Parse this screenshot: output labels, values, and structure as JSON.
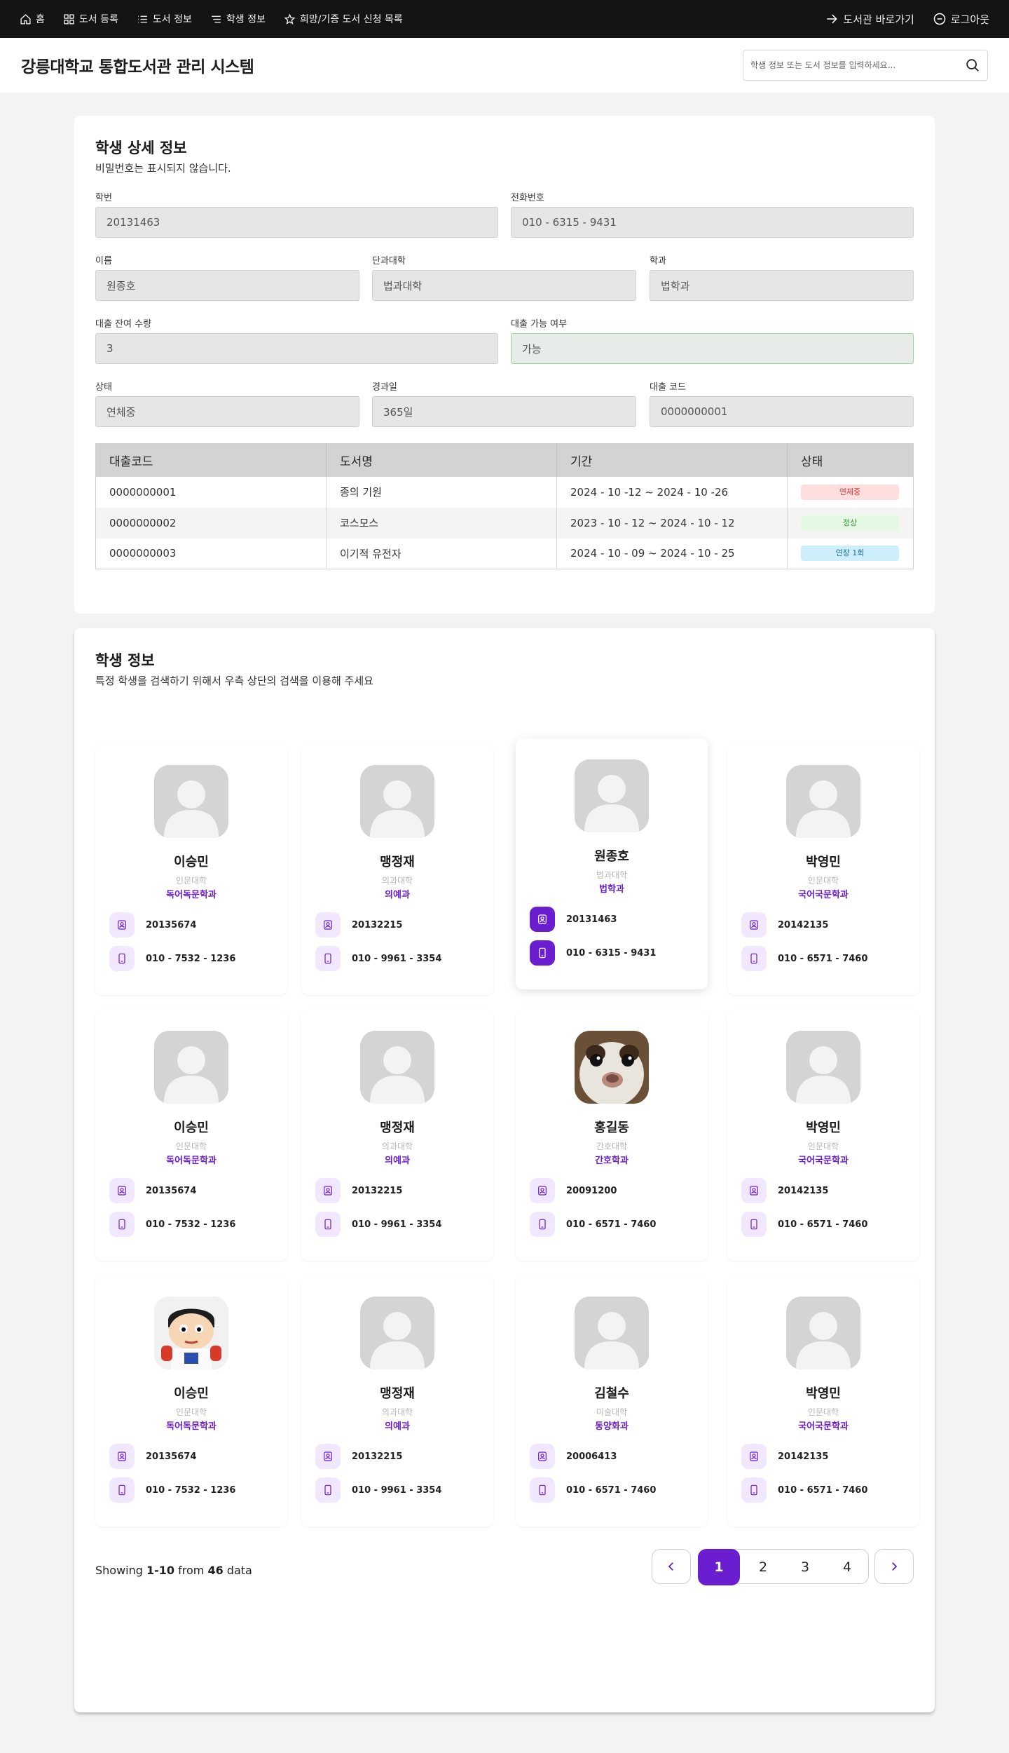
{
  "nav": {
    "items": [
      {
        "label": "홈",
        "icon": "home-icon"
      },
      {
        "label": "도서 등록",
        "icon": "grid-icon"
      },
      {
        "label": "도서 정보",
        "icon": "list-icon"
      },
      {
        "label": "학생 정보",
        "icon": "sort-icon"
      },
      {
        "label": "희망/기증 도서 신청 목록",
        "icon": "star-icon"
      }
    ],
    "library_link": "도서관 바로가기",
    "logout": "로그아웃"
  },
  "header": {
    "title": "강릉대학교 통합도서관 관리 시스템",
    "search_placeholder": "학생 정보 또는 도서 정보를 입력하세요..."
  },
  "detail": {
    "title": "학생 상세 정보",
    "subtitle": "비밀번호는 표시되지 않습니다.",
    "fields": {
      "student_id": {
        "label": "학번",
        "value": "20131463"
      },
      "phone": {
        "label": "전화번호",
        "value": "010 - 6315 - 9431"
      },
      "name": {
        "label": "이름",
        "value": "원종호"
      },
      "college": {
        "label": "단과대학",
        "value": "법과대학"
      },
      "dept": {
        "label": "학과",
        "value": "법학과"
      },
      "remaining": {
        "label": "대출 잔여 수량",
        "value": "3"
      },
      "available": {
        "label": "대출 가능 여부",
        "value": "가능"
      },
      "status": {
        "label": "상태",
        "value": "연체중"
      },
      "elapsed": {
        "label": "경과일",
        "value": "365일"
      },
      "loan_code": {
        "label": "대출 코드",
        "value": "0000000001"
      }
    },
    "table": {
      "headers": [
        "대출코드",
        "도서명",
        "기간",
        "상태"
      ],
      "rows": [
        {
          "code": "0000000001",
          "title": "종의 기원",
          "period": "2024 - 10 -12 ~ 2024 - 10 -26",
          "status": "연체중",
          "status_color": "#d93838",
          "status_bg": "#ffdede"
        },
        {
          "code": "0000000002",
          "title": "코스모스",
          "period": "2023 - 10 - 12 ~ 2024 - 10 - 12",
          "status": "정상",
          "status_color": "#3a9a3a",
          "status_bg": "#e4f8e4"
        },
        {
          "code": "0000000003",
          "title": "이기적 유전자",
          "period": "2024 - 10 - 09 ~ 2024 - 10 - 25",
          "status": "연장 1회",
          "status_color": "#1d6f9f",
          "status_bg": "#cdeefb"
        }
      ]
    }
  },
  "list": {
    "title": "학생 정보",
    "subtitle": "특정 학생을 검색하기 위해서 우측 상단의 검색을 이용해 주세요",
    "students": [
      {
        "name": "이승민",
        "college": "인문대학",
        "major": "독어독문학과",
        "id": "20135674",
        "phone": "010 - 7532 - 1236",
        "photo": "placeholder"
      },
      {
        "name": "맹정재",
        "college": "의과대학",
        "major": "의예과",
        "id": "20132215",
        "phone": "010 - 9961 - 3354",
        "photo": "placeholder"
      },
      {
        "name": "원종호",
        "college": "법과대학",
        "major": "법학과",
        "id": "20131463",
        "phone": "010 - 6315 - 9431",
        "photo": "placeholder",
        "active": true
      },
      {
        "name": "박영민",
        "college": "인문대학",
        "major": "국어국문학과",
        "id": "20142135",
        "phone": "010 - 6571 - 7460",
        "photo": "placeholder"
      },
      {
        "name": "이승민",
        "college": "인문대학",
        "major": "독어독문학과",
        "id": "20135674",
        "phone": "010 - 7532 - 1236",
        "photo": "placeholder"
      },
      {
        "name": "맹정재",
        "college": "의과대학",
        "major": "의예과",
        "id": "20132215",
        "phone": "010 - 9961 - 3354",
        "photo": "placeholder"
      },
      {
        "name": "홍길동",
        "college": "간호대학",
        "major": "간호학과",
        "id": "20091200",
        "phone": "010 - 6571 - 7460",
        "photo": "cat"
      },
      {
        "name": "박영민",
        "college": "인문대학",
        "major": "국어국문학과",
        "id": "20142135",
        "phone": "010 - 6571 - 7460",
        "photo": "placeholder"
      },
      {
        "name": "이승민",
        "college": "인문대학",
        "major": "독어독문학과",
        "id": "20135674",
        "phone": "010 - 7532 - 1236",
        "photo": "cartoon"
      },
      {
        "name": "맹정재",
        "college": "의과대학",
        "major": "의예과",
        "id": "20132215",
        "phone": "010 - 9961 - 3354",
        "photo": "placeholder"
      },
      {
        "name": "김철수",
        "college": "미술대학",
        "major": "동양화과",
        "id": "20006413",
        "phone": "010 - 6571 - 7460",
        "photo": "placeholder"
      },
      {
        "name": "박영민",
        "college": "인문대학",
        "major": "국어국문학과",
        "id": "20142135",
        "phone": "010 - 6571 - 7460",
        "photo": "placeholder"
      }
    ],
    "pagination": {
      "showing_prefix": "Showing ",
      "showing_range": "1-10",
      "showing_mid": " from ",
      "showing_total": "46",
      "showing_suffix": " data",
      "pages": [
        "1",
        "2",
        "3",
        "4"
      ],
      "current": "1"
    }
  },
  "colors": {
    "accent": "#6a1ecf",
    "nav_bg": "#141414"
  }
}
